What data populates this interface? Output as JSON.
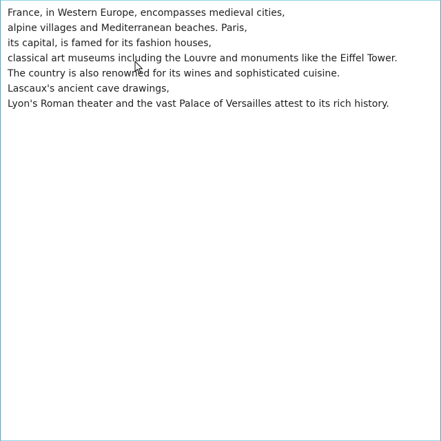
{
  "document": {
    "lines": [
      "France, in Western Europe, encompasses medieval cities,",
      "alpine villages and Mediterranean beaches. Paris,",
      "its capital, is famed for its fashion houses,",
      "classical art museums including the Louvre and monuments like the Eiffel Tower.",
      "The country is also renowned for its wines and sophisticated cuisine.",
      "Lascaux's ancient cave drawings,",
      "Lyon's Roman theater and the vast Palace of Versailles attest to its rich history."
    ]
  },
  "cursor": {
    "icon": "arrow-pointer-icon"
  },
  "colors": {
    "text": "#1e1e1e",
    "frame_border": "#3fa9c9",
    "background": "#ffffff"
  }
}
